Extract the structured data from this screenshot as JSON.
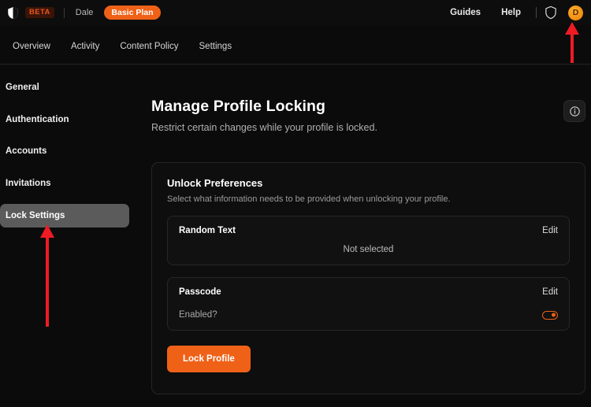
{
  "topbar": {
    "logo_icon": "shield-icon",
    "beta_label": "BETA",
    "user_name": "Dale",
    "plan_label": "Basic Plan",
    "links": [
      {
        "label": "Guides"
      },
      {
        "label": "Help"
      }
    ],
    "status_icon": "shield-outline-icon",
    "avatar_initial": "D",
    "avatar_color": "#f2960f"
  },
  "nav": {
    "items": [
      {
        "label": "Overview"
      },
      {
        "label": "Activity"
      },
      {
        "label": "Content Policy"
      },
      {
        "label": "Settings"
      }
    ]
  },
  "sidebar": {
    "items": [
      {
        "label": "General",
        "active": false
      },
      {
        "label": "Authentication",
        "active": false
      },
      {
        "label": "Accounts",
        "active": false
      },
      {
        "label": "Invitations",
        "active": false
      },
      {
        "label": "Lock Settings",
        "active": true
      }
    ]
  },
  "main": {
    "title": "Manage Profile Locking",
    "subtitle": "Restrict certain changes while your profile is locked.",
    "info_icon": "info-icon",
    "panel": {
      "title": "Unlock Preferences",
      "subtitle": "Select what information needs to be provided when unlocking your profile.",
      "cards": [
        {
          "title": "Random Text",
          "edit_label": "Edit",
          "center_value": "Not selected"
        },
        {
          "title": "Passcode",
          "edit_label": "Edit",
          "toggle_label": "Enabled?",
          "toggle_on": true,
          "toggle_color": "#ef6117"
        }
      ],
      "primary_button": "Lock Profile"
    }
  },
  "annotations": {
    "color": "#ee1b24",
    "arrows": [
      {
        "target": "avatar",
        "direction": "up"
      },
      {
        "target": "sidebar-item-lock-settings",
        "direction": "up"
      }
    ]
  }
}
